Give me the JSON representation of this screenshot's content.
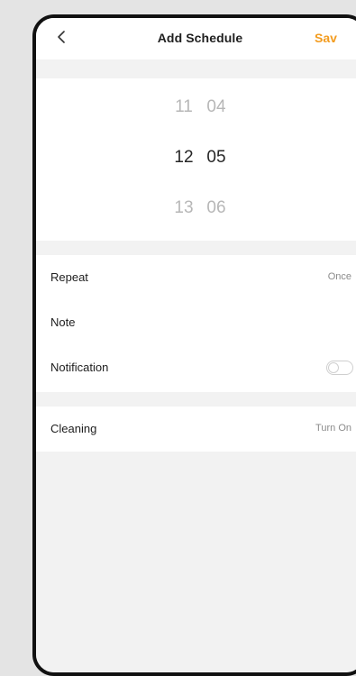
{
  "header": {
    "back_icon": "chevron-left-icon",
    "title": "Add Schedule",
    "save_label": "Sav"
  },
  "time_picker": {
    "previous": {
      "hour": "11",
      "minute": "04"
    },
    "selected": {
      "hour": "12",
      "minute": "05"
    },
    "next": {
      "hour": "13",
      "minute": "06"
    }
  },
  "settings": {
    "repeat": {
      "label": "Repeat",
      "value": "Once"
    },
    "note": {
      "label": "Note"
    },
    "notification": {
      "label": "Notification",
      "enabled": false
    },
    "cleaning": {
      "label": "Cleaning",
      "value": "Turn On"
    }
  },
  "colors": {
    "accent": "#f39c1f",
    "background": "#f2f2f2",
    "surface": "#ffffff",
    "text": "#202020",
    "muted": "#8b8b8b"
  }
}
